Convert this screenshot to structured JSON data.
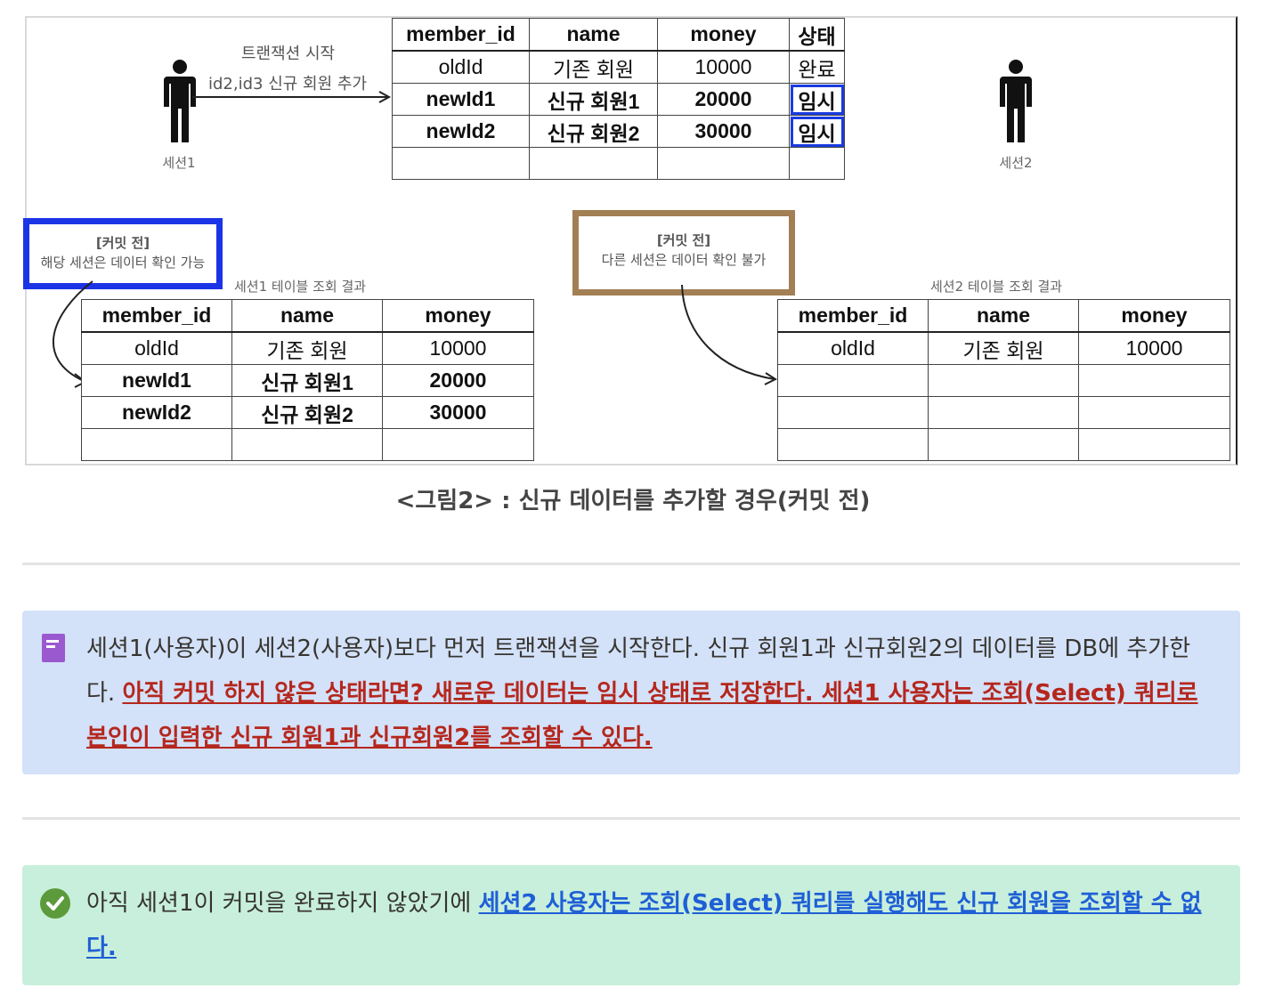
{
  "figure": {
    "session1_label": "세션1",
    "session2_label": "세션2",
    "tx_start_line1": "트랜잭션 시작",
    "tx_start_line2": "id2,id3 신규 회원 추가",
    "main_table": {
      "headers": [
        "member_id",
        "name",
        "money",
        "상태"
      ],
      "rows": [
        [
          "oldId",
          "기존 회원",
          "10000",
          "완료"
        ],
        [
          "newId1",
          "신규 회원1",
          "20000",
          "임시"
        ],
        [
          "newId2",
          "신규 회원2",
          "30000",
          "임시"
        ]
      ]
    },
    "note_left": {
      "title": "[커밋 전]",
      "text": "해당 세션은 데이터 확인 가능"
    },
    "note_right": {
      "title": "[커밋 전]",
      "text": "다른 세션은 데이터 확인 불가"
    },
    "session1_result_label": "세션1 테이블 조회 결과",
    "session2_result_label": "세션2 테이블 조회 결과",
    "session1_table": {
      "headers": [
        "member_id",
        "name",
        "money"
      ],
      "rows": [
        [
          "oldId",
          "기존 회원",
          "10000"
        ],
        [
          "newId1",
          "신규 회원1",
          "20000"
        ],
        [
          "newId2",
          "신규 회원2",
          "30000"
        ]
      ]
    },
    "session2_table": {
      "headers": [
        "member_id",
        "name",
        "money"
      ],
      "rows": [
        [
          "oldId",
          "기존 회원",
          "10000"
        ]
      ]
    },
    "highlight_color": "#1b35e6",
    "note_right_color": "#a37f54"
  },
  "caption": "<그림2> : 신규 데이터를 추가할 경우(커밋 전)",
  "callout_blue": {
    "icon": "document-icon",
    "plain": "세션1(사용자)이 세션2(사용자)보다 먼저 트랜잭션을 시작한다. 신규 회원1과 신규회원2의 데이터를 DB에 추가한다. ",
    "emphasis": "아직 커밋 하지 않은 상태라면? 새로운 데이터는 임시 상태로 저장한다. 세션1 사용자는 조회(Select) 쿼리로 본인이 입력한 신규 회원1과 신규회원2를 조회할 수 있다.",
    "bg": "#d3e1f9"
  },
  "callout_green": {
    "icon": "check-circle-icon",
    "plain": "아직 세션1이 커밋을 완료하지 않았기에 ",
    "emphasis": "세션2 사용자는 조회(Select) 쿼리를 실행해도 신규 회원을 조회할 수 없다.",
    "bg": "#c8efdb"
  }
}
